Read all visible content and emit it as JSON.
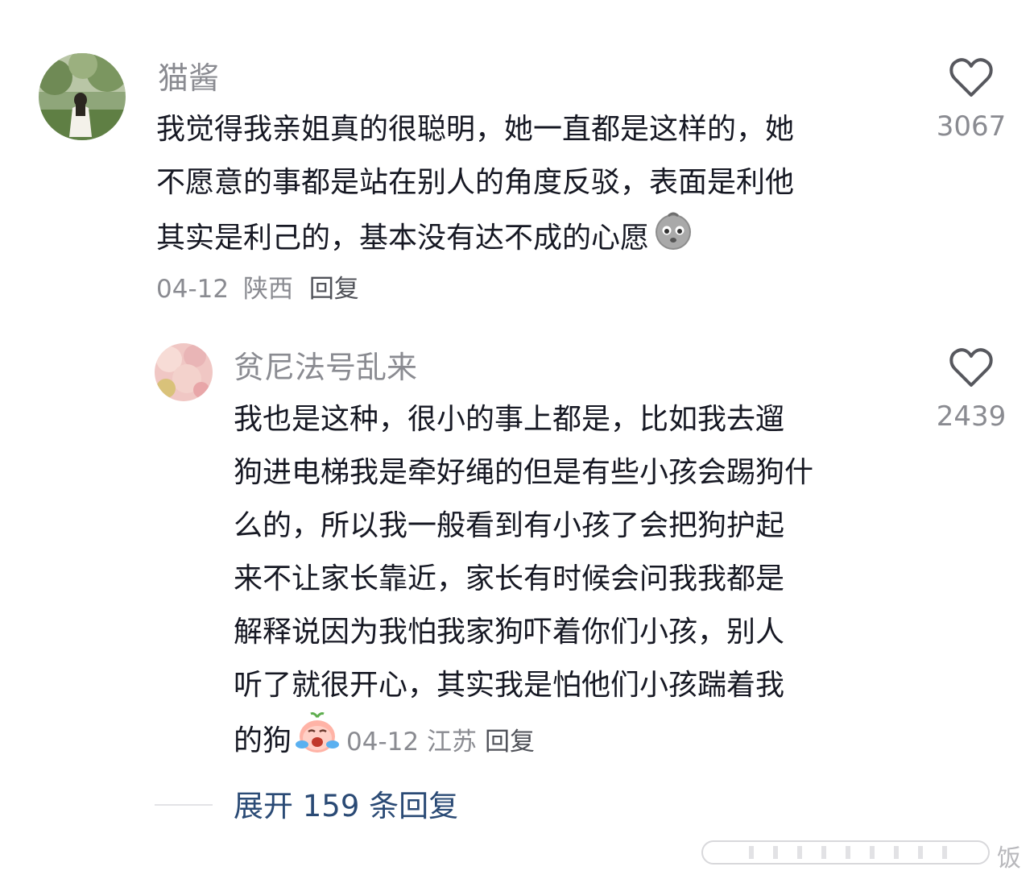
{
  "comments": [
    {
      "username": "猫酱",
      "lines": [
        "我觉得我亲姐真的很聪明，她一直都是这样的，她",
        "不愿意的事都是站在别人的角度反驳，表面是利他",
        "其实是利己的，基本没有达不成的心愿"
      ],
      "emoji": "potato-emoji",
      "date": "04-12",
      "location": "陕西",
      "reply_label": "回复",
      "likes": "3067"
    },
    {
      "username": "贫尼法号乱来",
      "lines": [
        "我也是这种，很小的事上都是，比如我去遛",
        "狗进电梯我是牵好绳的但是有些小孩会踢狗什",
        "么的，所以我一般看到有小孩了会把狗护起",
        "来不让家长靠近，家长有时候会问我我都是",
        "解释说因为我怕我家狗吓着你们小孩，别人",
        "听了就很开心，其实我是怕他们小孩踹着我",
        "的狗"
      ],
      "emoji": "crying-peach-emoji",
      "date": "04-12",
      "location": "江苏",
      "reply_label": "回复",
      "likes": "2439"
    }
  ],
  "expand_replies": "展开 159 条回复",
  "watermark": "饭",
  "colors": {
    "text": "#161823",
    "secondary": "#8a8b91",
    "link": "#2a4a75"
  }
}
